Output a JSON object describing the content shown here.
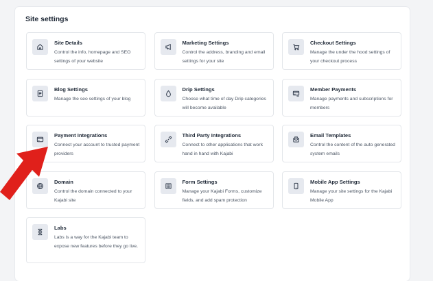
{
  "panel": {
    "title": "Site settings"
  },
  "cards": [
    {
      "title": "Site Details",
      "description": "Control the info, homepage and SEO settings of your website",
      "icon": "home-icon"
    },
    {
      "title": "Marketing Settings",
      "description": "Control the address, branding and email settings for your site",
      "icon": "megaphone-icon"
    },
    {
      "title": "Checkout Settings",
      "description": "Manage the under the hood settings of your checkout process",
      "icon": "cart-icon"
    },
    {
      "title": "Blog Settings",
      "description": "Manage the seo settings of your blog",
      "icon": "document-icon"
    },
    {
      "title": "Drip Settings",
      "description": "Choose what time of day Drip categories will become available",
      "icon": "droplet-icon"
    },
    {
      "title": "Member Payments",
      "description": "Manage payments and subscriptions for members",
      "icon": "receipt-icon"
    },
    {
      "title": "Payment Integrations",
      "description": "Connect your account to trusted payment providers",
      "icon": "credit-card-icon"
    },
    {
      "title": "Third Party Integrations",
      "description": "Connect to other applications that work hand in hand with Kajabi",
      "icon": "plug-icon"
    },
    {
      "title": "Email Templates",
      "description": "Control the content of the auto generated system emails",
      "icon": "envelope-icon"
    },
    {
      "title": "Domain",
      "description": "Control the domain connected to your Kajabi site",
      "icon": "globe-icon"
    },
    {
      "title": "Form Settings",
      "description": "Manage your Kajabi Forms, customize fields, and add spam protection",
      "icon": "form-icon"
    },
    {
      "title": "Mobile App Settings",
      "description": "Manage your site settings for the Kajabi Mobile App",
      "icon": "mobile-icon"
    },
    {
      "title": "Labs",
      "description": "Labs is a way for the Kajabi team to expose new features before they go live.",
      "icon": "hourglass-icon"
    }
  ],
  "colors": {
    "arrow": "#e0201b",
    "icon_bg": "#e6e9ef",
    "card_border": "#e3e6ea"
  }
}
